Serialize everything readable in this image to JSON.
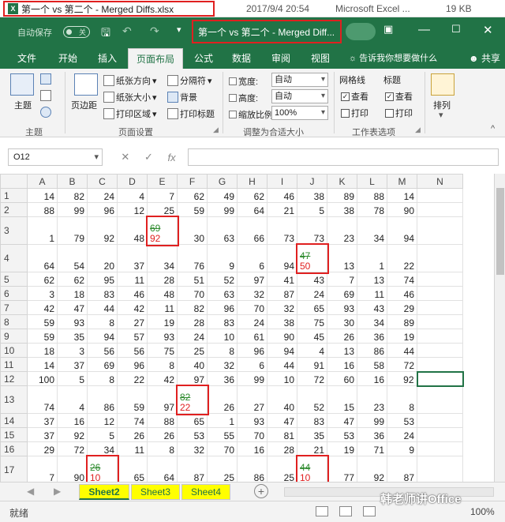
{
  "file_listing": {
    "icon_label": "X",
    "name": "第一个 vs 第二个 - Merged Diffs.xlsx",
    "date": "2017/9/4 20:54",
    "type": "Microsoft Excel ...",
    "size": "19 KB"
  },
  "titlebar": {
    "autosave": "自动保存",
    "toggle_state": "关",
    "title": "第一个 vs 第二个 - Merged Diff...",
    "save_icon": "save-icon",
    "undo_icon": "undo-icon",
    "redo_icon": "redo-icon"
  },
  "tabs": [
    "文件",
    "开始",
    "插入",
    "页面布局",
    "公式",
    "数据",
    "审阅",
    "视图"
  ],
  "active_tab": "页面布局",
  "tellme": "告诉我你想要做什么",
  "share": "共享",
  "ribbon": {
    "theme": {
      "label": "主题",
      "group": "主题"
    },
    "page_setup": {
      "margins": "页边距",
      "orientation": "纸张方向",
      "size": "纸张大小",
      "print_area": "打印区域",
      "breaks": "分隔符",
      "background": "背景",
      "print_titles": "打印标题",
      "group": "页面设置"
    },
    "scale": {
      "width_label": "宽度:",
      "width_value": "自动",
      "height_label": "高度:",
      "height_value": "自动",
      "scale_label": "缩放比例:",
      "scale_value": "100%",
      "group": "调整为合适大小"
    },
    "sheet_options": {
      "gridlines": "网格线",
      "headings": "标题",
      "view": "查看",
      "print": "打印",
      "group": "工作表选项"
    },
    "arrange": "排列"
  },
  "namebox": "O12",
  "formula_icons": {
    "cancel": "✕",
    "enter": "✓",
    "fx": "fx"
  },
  "columns": [
    "A",
    "B",
    "C",
    "D",
    "E",
    "F",
    "G",
    "H",
    "I",
    "J",
    "K",
    "L",
    "M",
    "N"
  ],
  "rows": [
    {
      "n": "1",
      "cells": [
        "14",
        "82",
        "24",
        "4",
        "7",
        "62",
        "49",
        "62",
        "46",
        "38",
        "89",
        "88",
        "14",
        ""
      ]
    },
    {
      "n": "2",
      "cells": [
        "88",
        "99",
        "96",
        "12",
        "25",
        "59",
        "99",
        "64",
        "21",
        "5",
        "38",
        "78",
        "90",
        ""
      ]
    },
    {
      "n": "3",
      "cells": [
        "1",
        "79",
        "92",
        "48",
        {
          "old": "69",
          "new": "92"
        },
        "30",
        "63",
        "66",
        "73",
        "73",
        "23",
        "34",
        "94",
        ""
      ]
    },
    {
      "n": "4",
      "cells": [
        "64",
        "54",
        "20",
        "37",
        "34",
        "76",
        "9",
        "6",
        "94",
        {
          "old": "47",
          "new": "50"
        },
        "13",
        "1",
        "22",
        ""
      ]
    },
    {
      "n": "5",
      "cells": [
        "62",
        "62",
        "95",
        "11",
        "28",
        "51",
        "52",
        "97",
        "41",
        "43",
        "7",
        "13",
        "74",
        ""
      ]
    },
    {
      "n": "6",
      "cells": [
        "3",
        "18",
        "83",
        "46",
        "48",
        "70",
        "63",
        "32",
        "87",
        "24",
        "69",
        "11",
        "46",
        ""
      ]
    },
    {
      "n": "7",
      "cells": [
        "42",
        "47",
        "44",
        "42",
        "11",
        "82",
        "96",
        "70",
        "32",
        "65",
        "93",
        "43",
        "29",
        ""
      ]
    },
    {
      "n": "8",
      "cells": [
        "59",
        "93",
        "8",
        "27",
        "19",
        "28",
        "83",
        "24",
        "38",
        "75",
        "30",
        "34",
        "89",
        ""
      ]
    },
    {
      "n": "9",
      "cells": [
        "59",
        "35",
        "94",
        "57",
        "93",
        "24",
        "10",
        "61",
        "90",
        "45",
        "26",
        "36",
        "19",
        ""
      ]
    },
    {
      "n": "10",
      "cells": [
        "18",
        "3",
        "56",
        "56",
        "75",
        "25",
        "8",
        "96",
        "94",
        "4",
        "13",
        "86",
        "44",
        ""
      ]
    },
    {
      "n": "11",
      "cells": [
        "14",
        "37",
        "69",
        "96",
        "8",
        "40",
        "32",
        "6",
        "44",
        "91",
        "16",
        "58",
        "72",
        ""
      ]
    },
    {
      "n": "12",
      "cells": [
        "100",
        "5",
        "8",
        "22",
        "42",
        "97",
        "36",
        "99",
        "10",
        "72",
        "60",
        "16",
        "92",
        ""
      ]
    },
    {
      "n": "13",
      "cells": [
        "74",
        "4",
        "86",
        "59",
        "97",
        {
          "old": "82",
          "new": "22"
        },
        "26",
        "27",
        "40",
        "52",
        "15",
        "23",
        "8",
        ""
      ]
    },
    {
      "n": "14",
      "cells": [
        "37",
        "16",
        "12",
        "74",
        "88",
        "65",
        "1",
        "93",
        "47",
        "83",
        "47",
        "99",
        "53",
        ""
      ]
    },
    {
      "n": "15",
      "cells": [
        "37",
        "92",
        "5",
        "26",
        "26",
        "53",
        "55",
        "70",
        "81",
        "35",
        "53",
        "36",
        "24",
        ""
      ]
    },
    {
      "n": "16",
      "cells": [
        "29",
        "72",
        "34",
        "11",
        "8",
        "32",
        "70",
        "16",
        "28",
        "21",
        "19",
        "71",
        "9",
        ""
      ]
    },
    {
      "n": "17",
      "cells": [
        "7",
        "90",
        {
          "old": "26",
          "new": "10"
        },
        "65",
        "64",
        "87",
        "25",
        "86",
        "25",
        {
          "old": "44",
          "new": "10"
        },
        "77",
        "92",
        "87",
        ""
      ]
    }
  ],
  "sheets": [
    "Sheet2",
    "Sheet3",
    "Sheet4"
  ],
  "active_sheet": "Sheet2",
  "status": {
    "ready": "就绪",
    "zoom": "100%",
    "watermark": "韩老师讲Office"
  },
  "colors": {
    "excel_green": "#217346",
    "diff_old": "#2e8b2e",
    "diff_new": "#e02020",
    "highlight_box": "#e02020",
    "sheet_tab": "#ffff00"
  }
}
